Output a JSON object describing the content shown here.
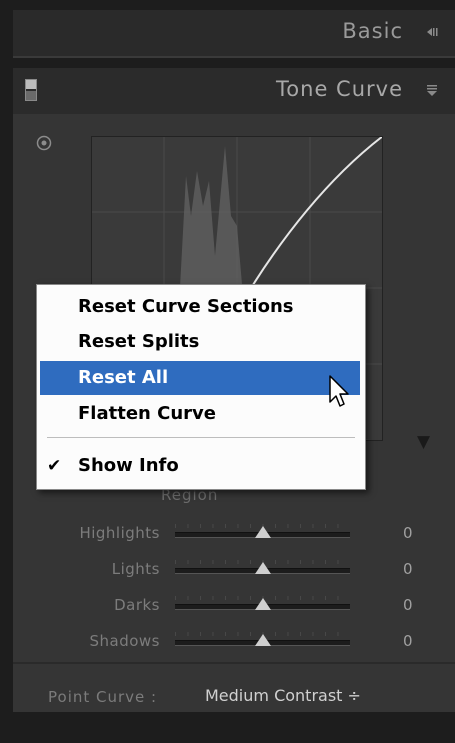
{
  "panels": {
    "basic": {
      "title": "Basic",
      "collapse_icon": "collapse-left-icon"
    },
    "tone_curve": {
      "title": "Tone Curve",
      "collapse_icon": "collapse-down-icon"
    }
  },
  "tone_curve": {
    "region_label": "Region",
    "sliders": [
      {
        "label": "Highlights",
        "value": "0",
        "position": 0.5
      },
      {
        "label": "Lights",
        "value": "0",
        "position": 0.5
      },
      {
        "label": "Darks",
        "value": "0",
        "position": 0.5
      },
      {
        "label": "Shadows",
        "value": "0",
        "position": 0.5
      }
    ],
    "point_curve": {
      "label": "Point Curve :",
      "value": "Medium Contrast ÷"
    }
  },
  "context_menu": {
    "items": [
      {
        "label": "Reset Curve Sections",
        "highlighted": false
      },
      {
        "label": "Reset Splits",
        "highlighted": false
      },
      {
        "label": "Reset All",
        "highlighted": true
      },
      {
        "label": "Flatten Curve",
        "highlighted": false
      }
    ],
    "checked_item": {
      "label": "Show Info",
      "checked": true
    }
  },
  "colors": {
    "menu_highlight": "#2f6cbf",
    "panel_bg": "#353535"
  }
}
